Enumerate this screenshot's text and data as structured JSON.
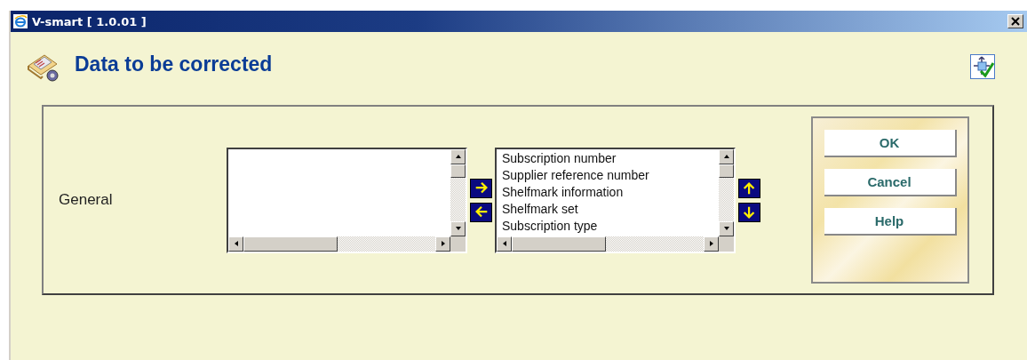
{
  "window": {
    "title": "V-smart [ 1.0.01 ]"
  },
  "heading": "Data to be corrected",
  "group": {
    "label": "General",
    "selected": {
      "items": [
        {
          "text": "Subscription number"
        },
        {
          "text": "Supplier reference number"
        },
        {
          "text": "Shelfmark information"
        },
        {
          "text": "Shelfmark set"
        },
        {
          "text": "Subscription type"
        }
      ]
    }
  },
  "buttons": [
    {
      "label": "OK"
    },
    {
      "label": "Cancel"
    },
    {
      "label": "Help"
    }
  ]
}
